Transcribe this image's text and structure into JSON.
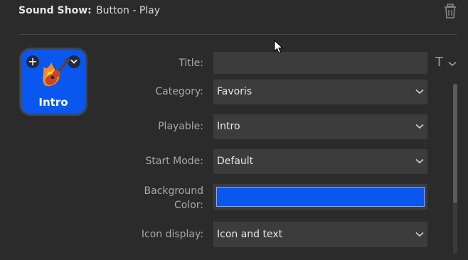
{
  "header": {
    "label": "Sound Show:",
    "value": "Button - Play"
  },
  "tile": {
    "label": "Intro",
    "plus": "+",
    "color": "#0a57f0"
  },
  "fields": {
    "title": {
      "label": "Title:",
      "value": ""
    },
    "category": {
      "label": "Category:",
      "value": "Favoris"
    },
    "playable": {
      "label": "Playable:",
      "value": "Intro"
    },
    "start_mode": {
      "label": "Start Mode:",
      "value": "Default"
    },
    "background": {
      "label_line1": "Background",
      "label_line2": "Color:",
      "color": "#0a57f0"
    },
    "icon_display": {
      "label": "Icon display:",
      "value": "Icon and text"
    }
  },
  "title_tool": {
    "glyph": "T"
  }
}
